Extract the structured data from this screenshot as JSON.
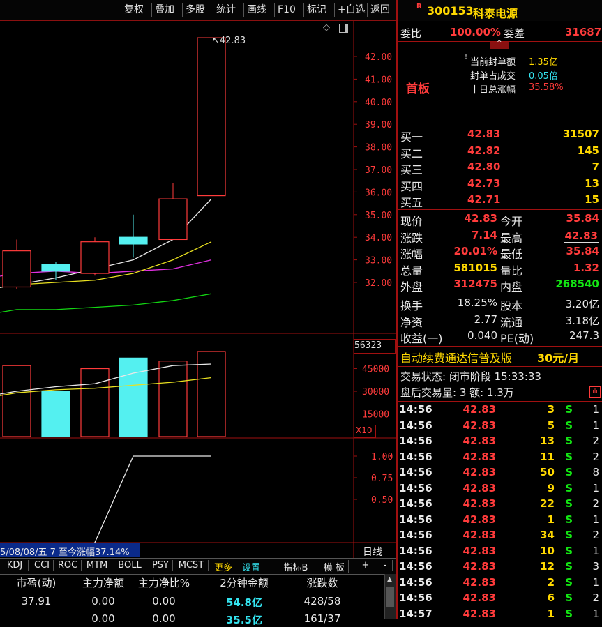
{
  "toolbar": {
    "buttons": [
      "复权",
      "叠加",
      "多股",
      "统计",
      "画线",
      "F10",
      "标记",
      "+自选",
      "返回"
    ]
  },
  "stock": {
    "badge": "R",
    "code": "300153",
    "name": "科泰电源"
  },
  "weibi": {
    "label1": "委比",
    "value1": "100.00%",
    "label2": "委差",
    "value2": "31687"
  },
  "limit_info": {
    "tag": "首板",
    "rows": [
      {
        "label": "当前封单额",
        "value": "1.35亿"
      },
      {
        "label": "封单占成交",
        "value": "0.05倍"
      },
      {
        "label": "十日总涨幅",
        "value": "35.58%"
      }
    ]
  },
  "bids": [
    {
      "label": "买一",
      "price": "42.83",
      "vol": "31507"
    },
    {
      "label": "买二",
      "price": "42.82",
      "vol": "145"
    },
    {
      "label": "买三",
      "price": "42.80",
      "vol": "7"
    },
    {
      "label": "买四",
      "price": "42.73",
      "vol": "13"
    },
    {
      "label": "买五",
      "price": "42.71",
      "vol": "15"
    }
  ],
  "quote": [
    {
      "l1": "现价",
      "v1": "42.83",
      "l2": "今开",
      "v2": "35.84"
    },
    {
      "l1": "涨跌",
      "v1": "7.14",
      "l2": "最高",
      "v2": "42.83"
    },
    {
      "l1": "涨幅",
      "v1": "20.01%",
      "l2": "最低",
      "v2": "35.84"
    },
    {
      "l1": "总量",
      "v1": "581015",
      "l2": "量比",
      "v2": "1.32"
    },
    {
      "l1": "外盘",
      "v1": "312475",
      "l2": "内盘",
      "v2": "268540"
    }
  ],
  "fundamentals": [
    {
      "l1": "换手",
      "v1": "18.25%",
      "l2": "股本",
      "v2": "3.20亿"
    },
    {
      "l1": "净资",
      "v1": "2.77",
      "l2": "流通",
      "v2": "3.18亿"
    },
    {
      "l1": "收益(一)",
      "v1": "0.040",
      "l2": "PE(动)",
      "v2": "247.3"
    }
  ],
  "promo": {
    "text": "自动续费通达信普及版",
    "price": "30元/月"
  },
  "trade_status": {
    "line1": "交易状态: 闭市阶段 15:33:33",
    "line2": "盘后交易量: 3  额: 1.3万"
  },
  "ticks": [
    {
      "t": "14:56",
      "p": "42.83",
      "v": "3",
      "s": "S",
      "n": "1"
    },
    {
      "t": "14:56",
      "p": "42.83",
      "v": "5",
      "s": "S",
      "n": "1"
    },
    {
      "t": "14:56",
      "p": "42.83",
      "v": "13",
      "s": "S",
      "n": "2"
    },
    {
      "t": "14:56",
      "p": "42.83",
      "v": "11",
      "s": "S",
      "n": "2"
    },
    {
      "t": "14:56",
      "p": "42.83",
      "v": "50",
      "s": "S",
      "n": "8"
    },
    {
      "t": "14:56",
      "p": "42.83",
      "v": "9",
      "s": "S",
      "n": "1"
    },
    {
      "t": "14:56",
      "p": "42.83",
      "v": "22",
      "s": "S",
      "n": "2"
    },
    {
      "t": "14:56",
      "p": "42.83",
      "v": "1",
      "s": "S",
      "n": "1"
    },
    {
      "t": "14:56",
      "p": "42.83",
      "v": "34",
      "s": "S",
      "n": "2"
    },
    {
      "t": "14:56",
      "p": "42.83",
      "v": "10",
      "s": "S",
      "n": "1"
    },
    {
      "t": "14:56",
      "p": "42.83",
      "v": "12",
      "s": "S",
      "n": "3"
    },
    {
      "t": "14:56",
      "p": "42.83",
      "v": "2",
      "s": "S",
      "n": "1"
    },
    {
      "t": "14:56",
      "p": "42.83",
      "v": "6",
      "s": "S",
      "n": "2"
    },
    {
      "t": "14:57",
      "p": "42.83",
      "v": "1",
      "s": "S",
      "n": "1"
    }
  ],
  "chart": {
    "price_axis": [
      "42.00",
      "41.00",
      "40.00",
      "39.00",
      "38.00",
      "37.00",
      "36.00",
      "35.00",
      "34.00",
      "33.00",
      "32.00"
    ],
    "high_label": "42.83",
    "vol_axis_top": "56323",
    "vol_axis": [
      "45000",
      "30000",
      "15000"
    ],
    "vol_unit": "X10",
    "ind_axis": [
      "1.00",
      "0.75",
      "0.50"
    ],
    "range_text": "5/08/08/五 7 至今涨幅37.14%",
    "period": "日线"
  },
  "chart_data": {
    "type": "candlestick",
    "candles": [
      {
        "open": 31.8,
        "close": 33.4,
        "high": 33.9,
        "low": 31.7
      },
      {
        "open": 32.8,
        "close": 32.5,
        "high": 32.9,
        "low": 32.1
      },
      {
        "open": 32.4,
        "close": 33.8,
        "high": 34.0,
        "low": 32.3
      },
      {
        "open": 34.0,
        "close": 33.7,
        "high": 35.0,
        "low": 33.1
      },
      {
        "open": 33.9,
        "close": 35.7,
        "high": 36.4,
        "low": 33.9
      },
      {
        "open": 35.84,
        "close": 42.83,
        "high": 42.83,
        "low": 35.84
      }
    ],
    "volumes": [
      47000,
      30000,
      45000,
      52000,
      50000,
      56323
    ],
    "ma_white": [
      31.9,
      32.2,
      32.6,
      33.0,
      33.9,
      35.7
    ],
    "ma_yellow": [
      31.9,
      32.0,
      32.1,
      32.4,
      33.0,
      33.8
    ],
    "ma_magenta": [
      32.4,
      32.5,
      32.4,
      32.5,
      32.6,
      33.0
    ],
    "ma_green": [
      30.8,
      30.8,
      30.9,
      31.0,
      31.2,
      31.5
    ],
    "vol_ma_white": [
      30000,
      33000,
      35000,
      42000,
      47000,
      48000
    ],
    "vol_ma_yellow": [
      29000,
      31000,
      32000,
      34000,
      36000,
      39000
    ],
    "indicator": [
      0.0,
      0.0,
      0.0,
      1.0,
      1.0,
      1.0
    ],
    "price_ylim": [
      31.5,
      43.0
    ]
  },
  "indicator_tabs": [
    "KDJ",
    "CCI",
    "ROC",
    "MTM",
    "BOLL",
    "PSY",
    "MCST",
    "更多",
    "设置",
    "指标B",
    "模 板",
    "+",
    "-"
  ],
  "stats_table": {
    "headers": [
      "市盈(动)",
      "主力净额",
      "主力净比%",
      "2分钟金额",
      "涨跌数"
    ],
    "rows": [
      [
        "37.91",
        "0.00",
        "0.00",
        "54.8亿",
        "428/58"
      ],
      [
        "",
        "0.00",
        "0.00",
        "35.5亿",
        "161/37"
      ]
    ]
  }
}
